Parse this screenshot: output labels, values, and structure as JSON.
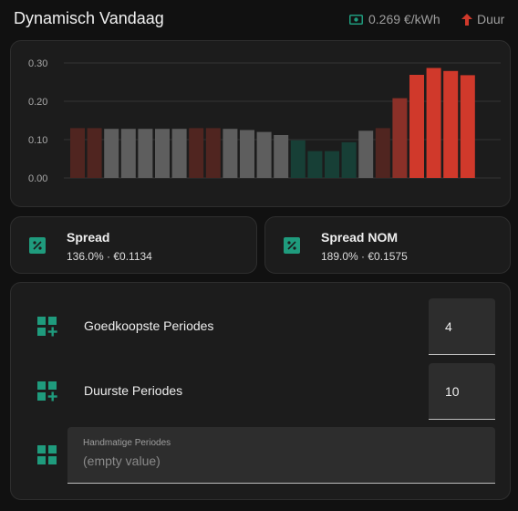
{
  "header": {
    "title": "Dynamisch Vandaag",
    "price": "0.269 €/kWh",
    "price_icon": "cash-icon",
    "trend": "Duur",
    "trend_icon": "arrow-up-icon"
  },
  "colors": {
    "accent": "#1f9b7d",
    "neutral_bar": "#5e5e5e",
    "dark_red_bar": "#502520",
    "medium_red_bar": "#8a3028",
    "bright_red_bar": "#d0392b",
    "dark_green_bar": "#173f36"
  },
  "chart_data": {
    "type": "bar",
    "y_ticks": [
      "0.30",
      "0.20",
      "0.10",
      "0.00"
    ],
    "ylim": [
      0,
      0.3
    ],
    "values": [
      0.13,
      0.13,
      0.128,
      0.128,
      0.128,
      0.128,
      0.128,
      0.13,
      0.13,
      0.128,
      0.125,
      0.12,
      0.112,
      0.098,
      0.07,
      0.07,
      0.093,
      0.123,
      0.13,
      0.208,
      0.269,
      0.287,
      0.279,
      0.268
    ],
    "bar_colors": [
      "dark_red",
      "dark_red",
      "neutral",
      "neutral",
      "neutral",
      "neutral",
      "neutral",
      "dark_red",
      "dark_red",
      "neutral",
      "neutral",
      "neutral",
      "neutral",
      "dark_green",
      "dark_green",
      "dark_green",
      "dark_green",
      "neutral",
      "dark_red",
      "medium_red",
      "bright_red",
      "bright_red",
      "bright_red",
      "bright_red"
    ],
    "grid": true
  },
  "spread_cards": [
    {
      "title": "Spread",
      "value": "136.0% · €0.1134",
      "icon": "percent-box-icon"
    },
    {
      "title": "Spread NOM",
      "value": "189.0% · €0.1575",
      "icon": "percent-box-icon"
    }
  ],
  "settings": {
    "cheapest": {
      "label": "Goedkoopste Periodes",
      "value": "4",
      "icon": "view-grid-plus-icon"
    },
    "expensive": {
      "label": "Duurste Periodes",
      "value": "10",
      "icon": "view-grid-plus-icon"
    },
    "manual": {
      "label": "Handmatige Periodes",
      "placeholder": "(empty value)",
      "icon": "view-grid-icon"
    }
  }
}
